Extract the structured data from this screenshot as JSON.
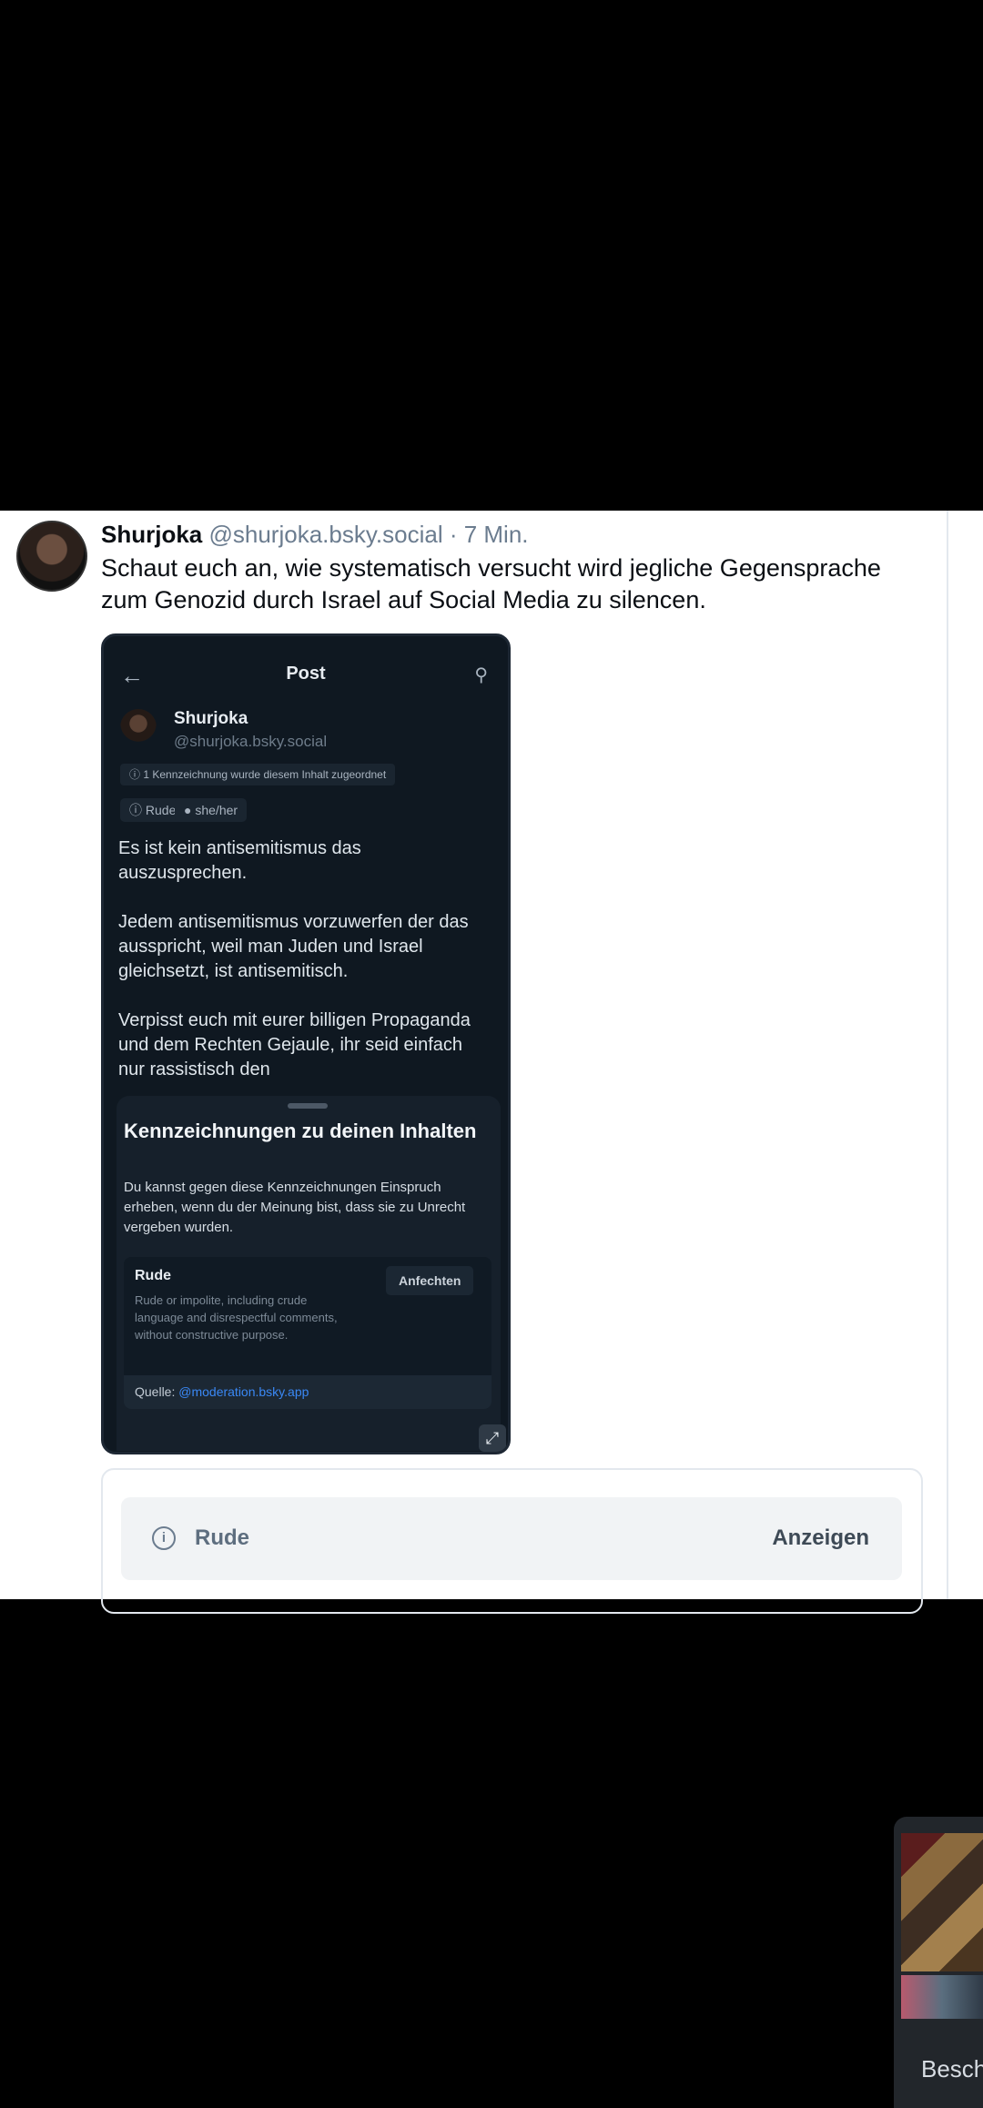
{
  "post": {
    "author_name": "Shurjoka",
    "author_handle": "@shurjoka.bsky.social",
    "time": " · 7 Min.",
    "text": "Schaut euch an, wie systematisch versucht wird jegliche Gegensprache zum Genozid durch Israel auf Social Media zu silencen."
  },
  "screenshot": {
    "header_title": "Post",
    "name": "Shurjoka",
    "handle": "@shurjoka.bsky.social",
    "label_notice": "1 Kennzeichnung wurde diesem Inhalt zugeordnet",
    "chips": [
      "Rude",
      "she/her"
    ],
    "body_paragraphs": [
      "Es ist kein antisemitismus das auszusprechen.",
      "Jedem antisemitismus vorzuwerfen der das ausspricht, weil man Juden und Israel gleichsetzt, ist antisemitisch.",
      "Verpisst euch mit eurer billigen Propaganda und dem Rechten Gejaule, ihr seid einfach nur rassistisch den"
    ],
    "sheet_title": "Kennzeichnungen zu deinen Inhalten",
    "sheet_desc": "Du kannst gegen diese Kennzeichnungen Einspruch erheben, wenn du der Meinung bist, dass sie zu Unrecht vergeben wurden.",
    "card_title": "Rude",
    "card_desc": "Rude or impolite, including crude language and disrespectful comments, without constructive purpose.",
    "appeal_label": "Anfechten",
    "source_prefix": "Quelle: ",
    "source_link": "@moderation.bsky.app"
  },
  "label_bar": {
    "label": "Rude",
    "show_label": "Anzeigen"
  },
  "thumb": {
    "label": "Besch"
  }
}
